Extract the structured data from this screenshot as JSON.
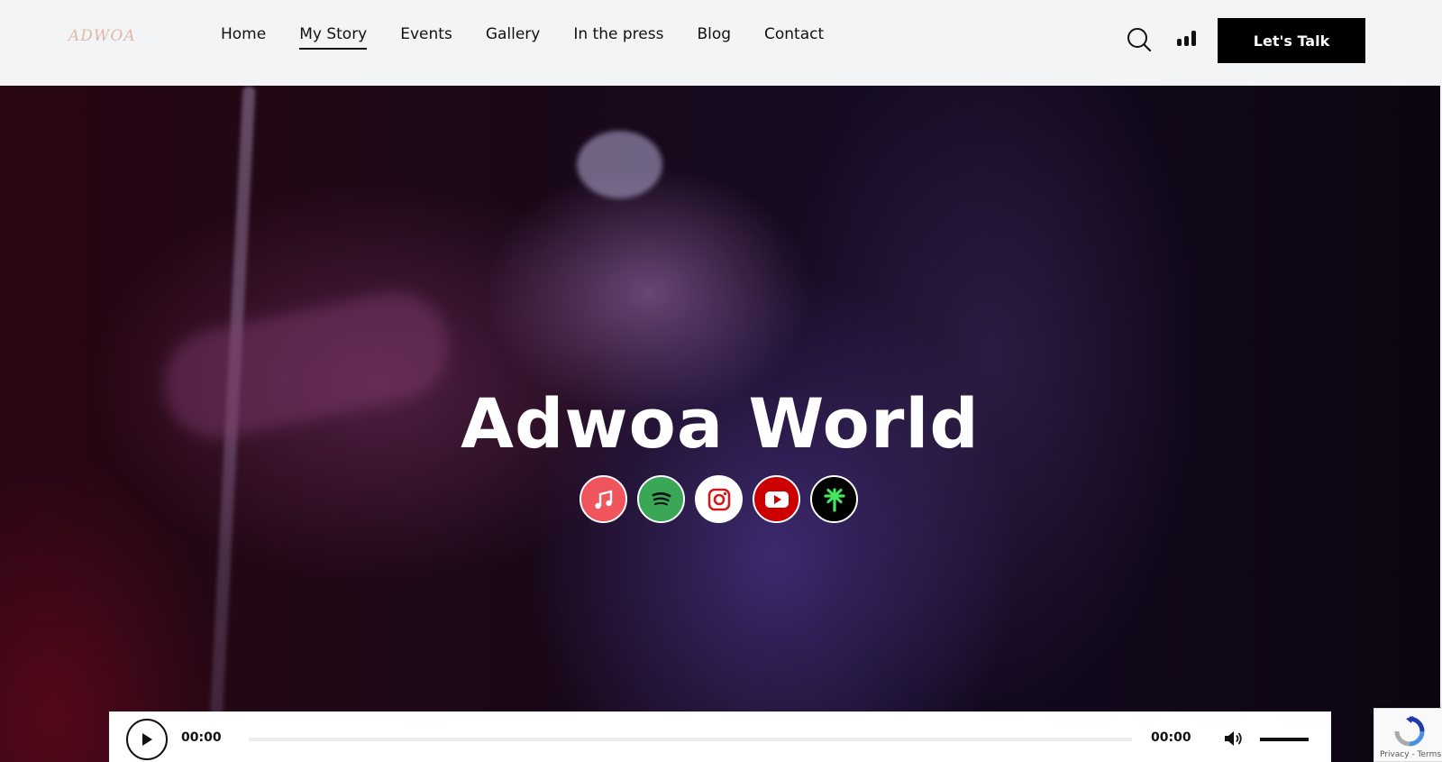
{
  "header": {
    "logo_text": "ADWOA",
    "nav": [
      {
        "label": "Home",
        "active": false
      },
      {
        "label": "My Story",
        "active": true
      },
      {
        "label": "Events",
        "active": false
      },
      {
        "label": "Gallery",
        "active": false
      },
      {
        "label": "In the press",
        "active": false
      },
      {
        "label": "Blog",
        "active": false
      },
      {
        "label": "Contact",
        "active": false
      }
    ],
    "search_icon": "search-icon",
    "bars_icon": "bar-chart-icon",
    "cta_label": "Let's Talk"
  },
  "hero": {
    "title": "Adwoa World",
    "socials": [
      {
        "name": "apple-music-icon",
        "color": "#f0555e"
      },
      {
        "name": "spotify-icon",
        "color": "#3aa757"
      },
      {
        "name": "instagram-icon",
        "color": "#ffffff"
      },
      {
        "name": "youtube-icon",
        "color": "#cc0000"
      },
      {
        "name": "linktree-icon",
        "color": "#000000"
      }
    ]
  },
  "player": {
    "current_time": "00:00",
    "duration": "00:00",
    "progress": 0,
    "volume": 1.0
  },
  "recaptcha": {
    "links": "Privacy - Terms"
  }
}
